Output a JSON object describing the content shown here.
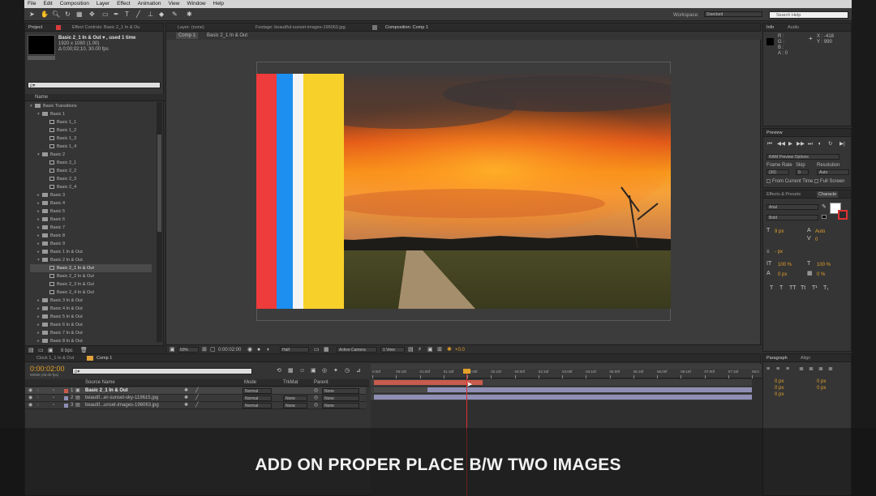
{
  "menu": [
    "File",
    "Edit",
    "Composition",
    "Layer",
    "Effect",
    "Animation",
    "View",
    "Window",
    "Help"
  ],
  "toolbar": {
    "workspace_label": "Workspace:",
    "workspace_value": "Standard",
    "search_placeholder": "Search Help"
  },
  "project": {
    "tab_project": "Project",
    "tab_effect_controls": "Effect Controls: Basic 2_1 In & Ou",
    "comp_name": "Basic 2_1 In & Out ▾ , used 1 time",
    "comp_size": "1920 x 1080 (1.00)",
    "comp_duration": "Δ 0;00;02;10, 30.00 fps",
    "search_placeholder": "ρ▾",
    "col_name": "Name",
    "items": [
      {
        "label": "Basic Transitions",
        "kind": "folder",
        "indent": 1,
        "open": true
      },
      {
        "label": "Basic 1",
        "kind": "folder",
        "indent": 2,
        "open": true
      },
      {
        "label": "Basic 1_1",
        "kind": "comp",
        "indent": 3
      },
      {
        "label": "Basic 1_2",
        "kind": "comp",
        "indent": 3
      },
      {
        "label": "Basic 1_3",
        "kind": "comp",
        "indent": 3
      },
      {
        "label": "Basic 1_4",
        "kind": "comp",
        "indent": 3
      },
      {
        "label": "Basic 2",
        "kind": "folder",
        "indent": 2,
        "open": true
      },
      {
        "label": "Basic 2_1",
        "kind": "comp",
        "indent": 3
      },
      {
        "label": "Basic 2_2",
        "kind": "comp",
        "indent": 3
      },
      {
        "label": "Basic 2_3",
        "kind": "comp",
        "indent": 3
      },
      {
        "label": "Basic 2_4",
        "kind": "comp",
        "indent": 3
      },
      {
        "label": "Basic 3",
        "kind": "folder",
        "indent": 2
      },
      {
        "label": "Basic 4",
        "kind": "folder",
        "indent": 2
      },
      {
        "label": "Basic 5",
        "kind": "folder",
        "indent": 2
      },
      {
        "label": "Basic 6",
        "kind": "folder",
        "indent": 2
      },
      {
        "label": "Basic 7",
        "kind": "folder",
        "indent": 2
      },
      {
        "label": "Basic 8",
        "kind": "folder",
        "indent": 2
      },
      {
        "label": "Basic 9",
        "kind": "folder",
        "indent": 2
      },
      {
        "label": "Basic 1 In & Out",
        "kind": "folder",
        "indent": 2
      },
      {
        "label": "Basic 2 In & Out",
        "kind": "folder",
        "indent": 2,
        "open": true
      },
      {
        "label": "Basic 2_1 In & Out",
        "kind": "comp",
        "indent": 3,
        "selected": true
      },
      {
        "label": "Basic 2_2 In & Out",
        "kind": "comp",
        "indent": 3
      },
      {
        "label": "Basic 2_3 In & Out",
        "kind": "comp",
        "indent": 3
      },
      {
        "label": "Basic 2_4 In & Out",
        "kind": "comp",
        "indent": 3
      },
      {
        "label": "Basic 3 In & Out",
        "kind": "folder",
        "indent": 2
      },
      {
        "label": "Basic 4 In & Out",
        "kind": "folder",
        "indent": 2
      },
      {
        "label": "Basic 5 In & Out",
        "kind": "folder",
        "indent": 2
      },
      {
        "label": "Basic 6 In & Out",
        "kind": "folder",
        "indent": 2
      },
      {
        "label": "Basic 7 In & Out",
        "kind": "folder",
        "indent": 2
      },
      {
        "label": "Basic 8 In & Out",
        "kind": "folder",
        "indent": 2
      }
    ],
    "bpc": "8 bpc"
  },
  "viewer": {
    "tab_layer": "Layer: (none)",
    "tab_footage": "Footage: beautiful-sunset-images-196063.jpg",
    "tab_composition": "Composition: Comp 1",
    "breadcrumb_comp": "Comp 1",
    "breadcrumb_item": "Basic 2_1 In & Out",
    "zoom": "50%",
    "timecode": "0:00:02:00",
    "resolution": "Half",
    "camera": "Active Camera",
    "views": "1 View",
    "exposure": "+0.0",
    "stripe_colors": [
      "#ee3b3b",
      "#1c8ff0",
      "#f4f4f4",
      "#f8d02a"
    ]
  },
  "info": {
    "tab_info": "Info",
    "tab_audio": "Audio",
    "r": "R :",
    "g": "G :",
    "b": "B :",
    "a": "A : 0",
    "x": "X : -418",
    "y": "Y : 990"
  },
  "preview": {
    "title": "Preview",
    "ram_options": "RAM Preview Options",
    "frame_rate_label": "Frame Rate",
    "skip_label": "Skip",
    "resolution_label": "Resolution",
    "frame_rate": "(30)",
    "skip": "0",
    "resolution": "Auto",
    "from_current": "From Current Time",
    "full_screen": "Full Screen"
  },
  "character": {
    "tab_effects": "Effects & Presets",
    "tab_character": "Characte",
    "font": "Arial",
    "style": "Bold",
    "size": "9 px",
    "leading": "Auto",
    "tracking": "0",
    "scale_v": "100 %",
    "scale_h": "100 %",
    "baseline": "0 px",
    "tsume": "0 %",
    "stroke": "- px"
  },
  "paragraph": {
    "tab_paragraph": "Paragraph",
    "tab_align": "Align",
    "indent_left": "0 px",
    "indent_right": "0 px",
    "space_before": "0 px",
    "space_after": "0 px",
    "first_line": "0 px"
  },
  "timeline": {
    "tab_other": "Clock 1_1 In & Out",
    "tab_comp": "Comp 1",
    "timecode": "0:00:02:00",
    "timecode_sub": "00060 (30.00 fps)",
    "search_placeholder": "ρ▾",
    "col_source": "Source Name",
    "col_mode": "Mode",
    "col_trkmat": "TrkMat",
    "col_parent": "Parent",
    "ruler": [
      "0:00f",
      "00:15f",
      "01:00f",
      "01:15f",
      "02:00f",
      "02:15f",
      "03:00f",
      "03:15f",
      "04:00f",
      "04:15f",
      "05:00f",
      "05:15f",
      "06:00f",
      "06:15f",
      "07:00f",
      "07:15f",
      "08:0"
    ],
    "layers": [
      {
        "num": "1",
        "name": "Basic 2_1 In & Out",
        "mode": "Normal",
        "trkmat": "",
        "parent": "None",
        "color": "#c95b4c"
      },
      {
        "num": "2",
        "name": "beautif...er-sunset-sky-119615.jpg",
        "mode": "Normal",
        "trkmat": "None",
        "parent": "None",
        "color": "#8f8fb5"
      },
      {
        "num": "3",
        "name": "beautif...unset-images-196063.jpg",
        "mode": "Normal",
        "trkmat": "None",
        "parent": "None",
        "color": "#8f8fb5"
      }
    ]
  },
  "caption": "ADD ON PROPER PLACE B/W TWO IMAGES"
}
